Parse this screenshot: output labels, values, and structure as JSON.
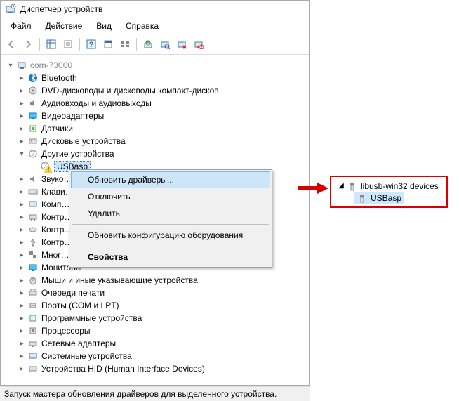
{
  "window": {
    "title": "Диспетчер устройств"
  },
  "menubar": [
    "Файл",
    "Действие",
    "Вид",
    "Справка"
  ],
  "tree": {
    "root": "com-73000",
    "items": [
      {
        "label": "Bluetooth",
        "exp": "closed"
      },
      {
        "label": "DVD-дисководы и дисководы компакт-дисков",
        "exp": "closed"
      },
      {
        "label": "Аудиовходы и аудиовыходы",
        "exp": "closed"
      },
      {
        "label": "Видеоадаптеры",
        "exp": "closed"
      },
      {
        "label": "Датчики",
        "exp": "closed"
      },
      {
        "label": "Дисковые устройства",
        "exp": "closed"
      },
      {
        "label": "Другие устройства",
        "exp": "open"
      },
      {
        "label": "Звуко…",
        "exp": "closed",
        "trunc": true
      },
      {
        "label": "Клави…",
        "exp": "closed",
        "trunc": true
      },
      {
        "label": "Комп…",
        "exp": "closed",
        "trunc": true
      },
      {
        "label": "Контр…",
        "exp": "closed",
        "trunc": true
      },
      {
        "label": "Контр…",
        "exp": "closed",
        "trunc": true
      },
      {
        "label": "Контр…",
        "exp": "closed",
        "trunc": true
      },
      {
        "label": "Мног…",
        "exp": "closed",
        "trunc": true
      },
      {
        "label": "Мониторы",
        "exp": "closed"
      },
      {
        "label": "Мыши и иные указывающие устройства",
        "exp": "closed"
      },
      {
        "label": "Очереди печати",
        "exp": "closed"
      },
      {
        "label": "Порты (COM и LPT)",
        "exp": "closed"
      },
      {
        "label": "Программные устройства",
        "exp": "closed"
      },
      {
        "label": "Процессоры",
        "exp": "closed"
      },
      {
        "label": "Сетевые адаптеры",
        "exp": "closed"
      },
      {
        "label": "Системные устройства",
        "exp": "closed"
      },
      {
        "label": "Устройства HID (Human Interface Devices)",
        "exp": "closed"
      }
    ],
    "usbasp": "USBasp"
  },
  "context_menu": {
    "items": [
      "Обновить драйверы...",
      "Отключить",
      "Удалить",
      "Обновить конфигурацию оборудования",
      "Свойства"
    ]
  },
  "statusbar": "Запуск мастера обновления драйверов для выделенного устройства.",
  "result": {
    "parent": "libusb-win32 devices",
    "child": "USBasp"
  }
}
